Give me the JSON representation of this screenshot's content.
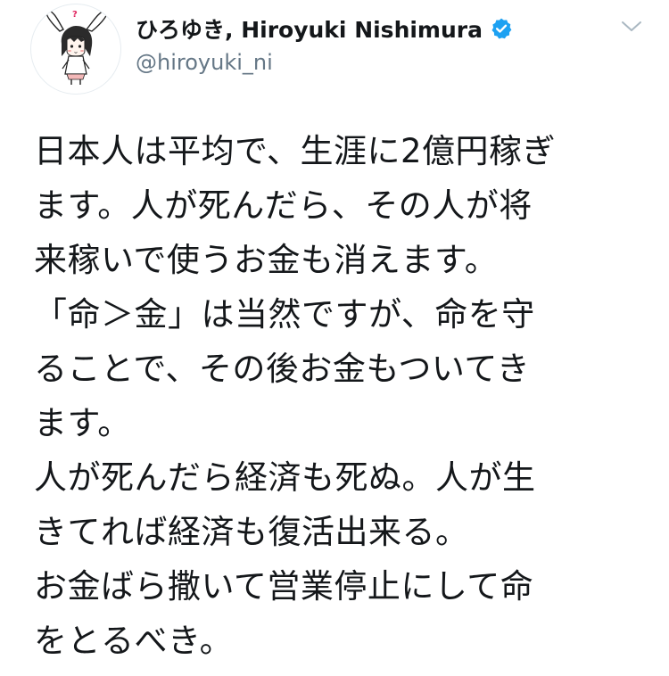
{
  "tweet": {
    "author": {
      "display_name": "ひろゆき, Hiroyuki Nishimura",
      "handle": "@hiroyuki_ni",
      "verified": true,
      "avatar_icon": "rabbit-ears-character-avatar"
    },
    "menu_icon": "chevron-down-icon",
    "text_lines": [
      "日本人は平均で、生涯に2億円稼ぎ",
      "ます。人が死んだら、その人が将",
      "来稼いで使うお金も消えます。",
      "「命＞金」は当然ですが、命を守",
      "ることで、その後お金もついてき",
      "ます。",
      "人が死んだら経済も死ぬ。人が生",
      "きてれば経済も復活出来る。",
      "お金ばら撒いて営業停止にして命",
      "をとるべき。"
    ]
  },
  "colors": {
    "text_primary": "#14171a",
    "text_secondary": "#657786",
    "verified_blue": "#1da1f2",
    "background": "#ffffff"
  }
}
